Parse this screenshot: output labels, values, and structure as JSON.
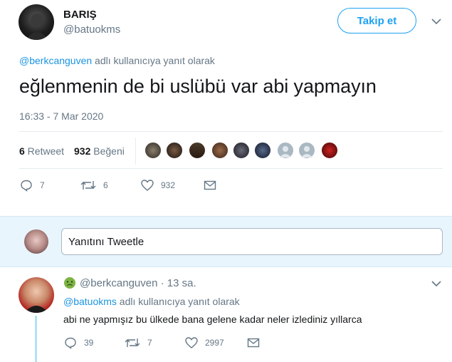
{
  "tweet": {
    "display_name": "BARIŞ",
    "handle": "@batuokms",
    "follow_label": "Takip et",
    "reply_to_handle": "@berkcanguven",
    "reply_to_suffix": " adlı kullanıcıya yanıt olarak",
    "text": "eğlenmenin de bi uslübü var abi yapmayın",
    "timestamp": "16:33 - 7 Mar 2020",
    "retweet_count": "6",
    "retweet_label": " Retweet",
    "like_count": "932",
    "like_label": " Beğeni",
    "actions": {
      "replies": "7",
      "retweets": "6",
      "likes": "932"
    }
  },
  "reply_composer": {
    "placeholder": "Yanıtını Tweetle"
  },
  "reply": {
    "handle": "@berkcanguven",
    "time": " · 13 sa.",
    "reply_to_handle": "@batuokms",
    "reply_to_suffix": " adlı kullanıcıya yanıt olarak",
    "text": "abi ne yapmışız bu ülkede bana gelene kadar neler izlediniz yıllarca",
    "actions": {
      "replies": "39",
      "retweets": "7",
      "likes": "2997"
    }
  },
  "colors": {
    "accent": "#1da1f2",
    "link": "#1b95e0",
    "muted": "#657786",
    "thread_line": "#b3e0fa",
    "divider": "#e6ecf0"
  },
  "icons": [
    "chevron-down-icon",
    "reply-icon",
    "retweet-icon",
    "like-icon",
    "dm-icon",
    "emoji-sick-icon"
  ]
}
